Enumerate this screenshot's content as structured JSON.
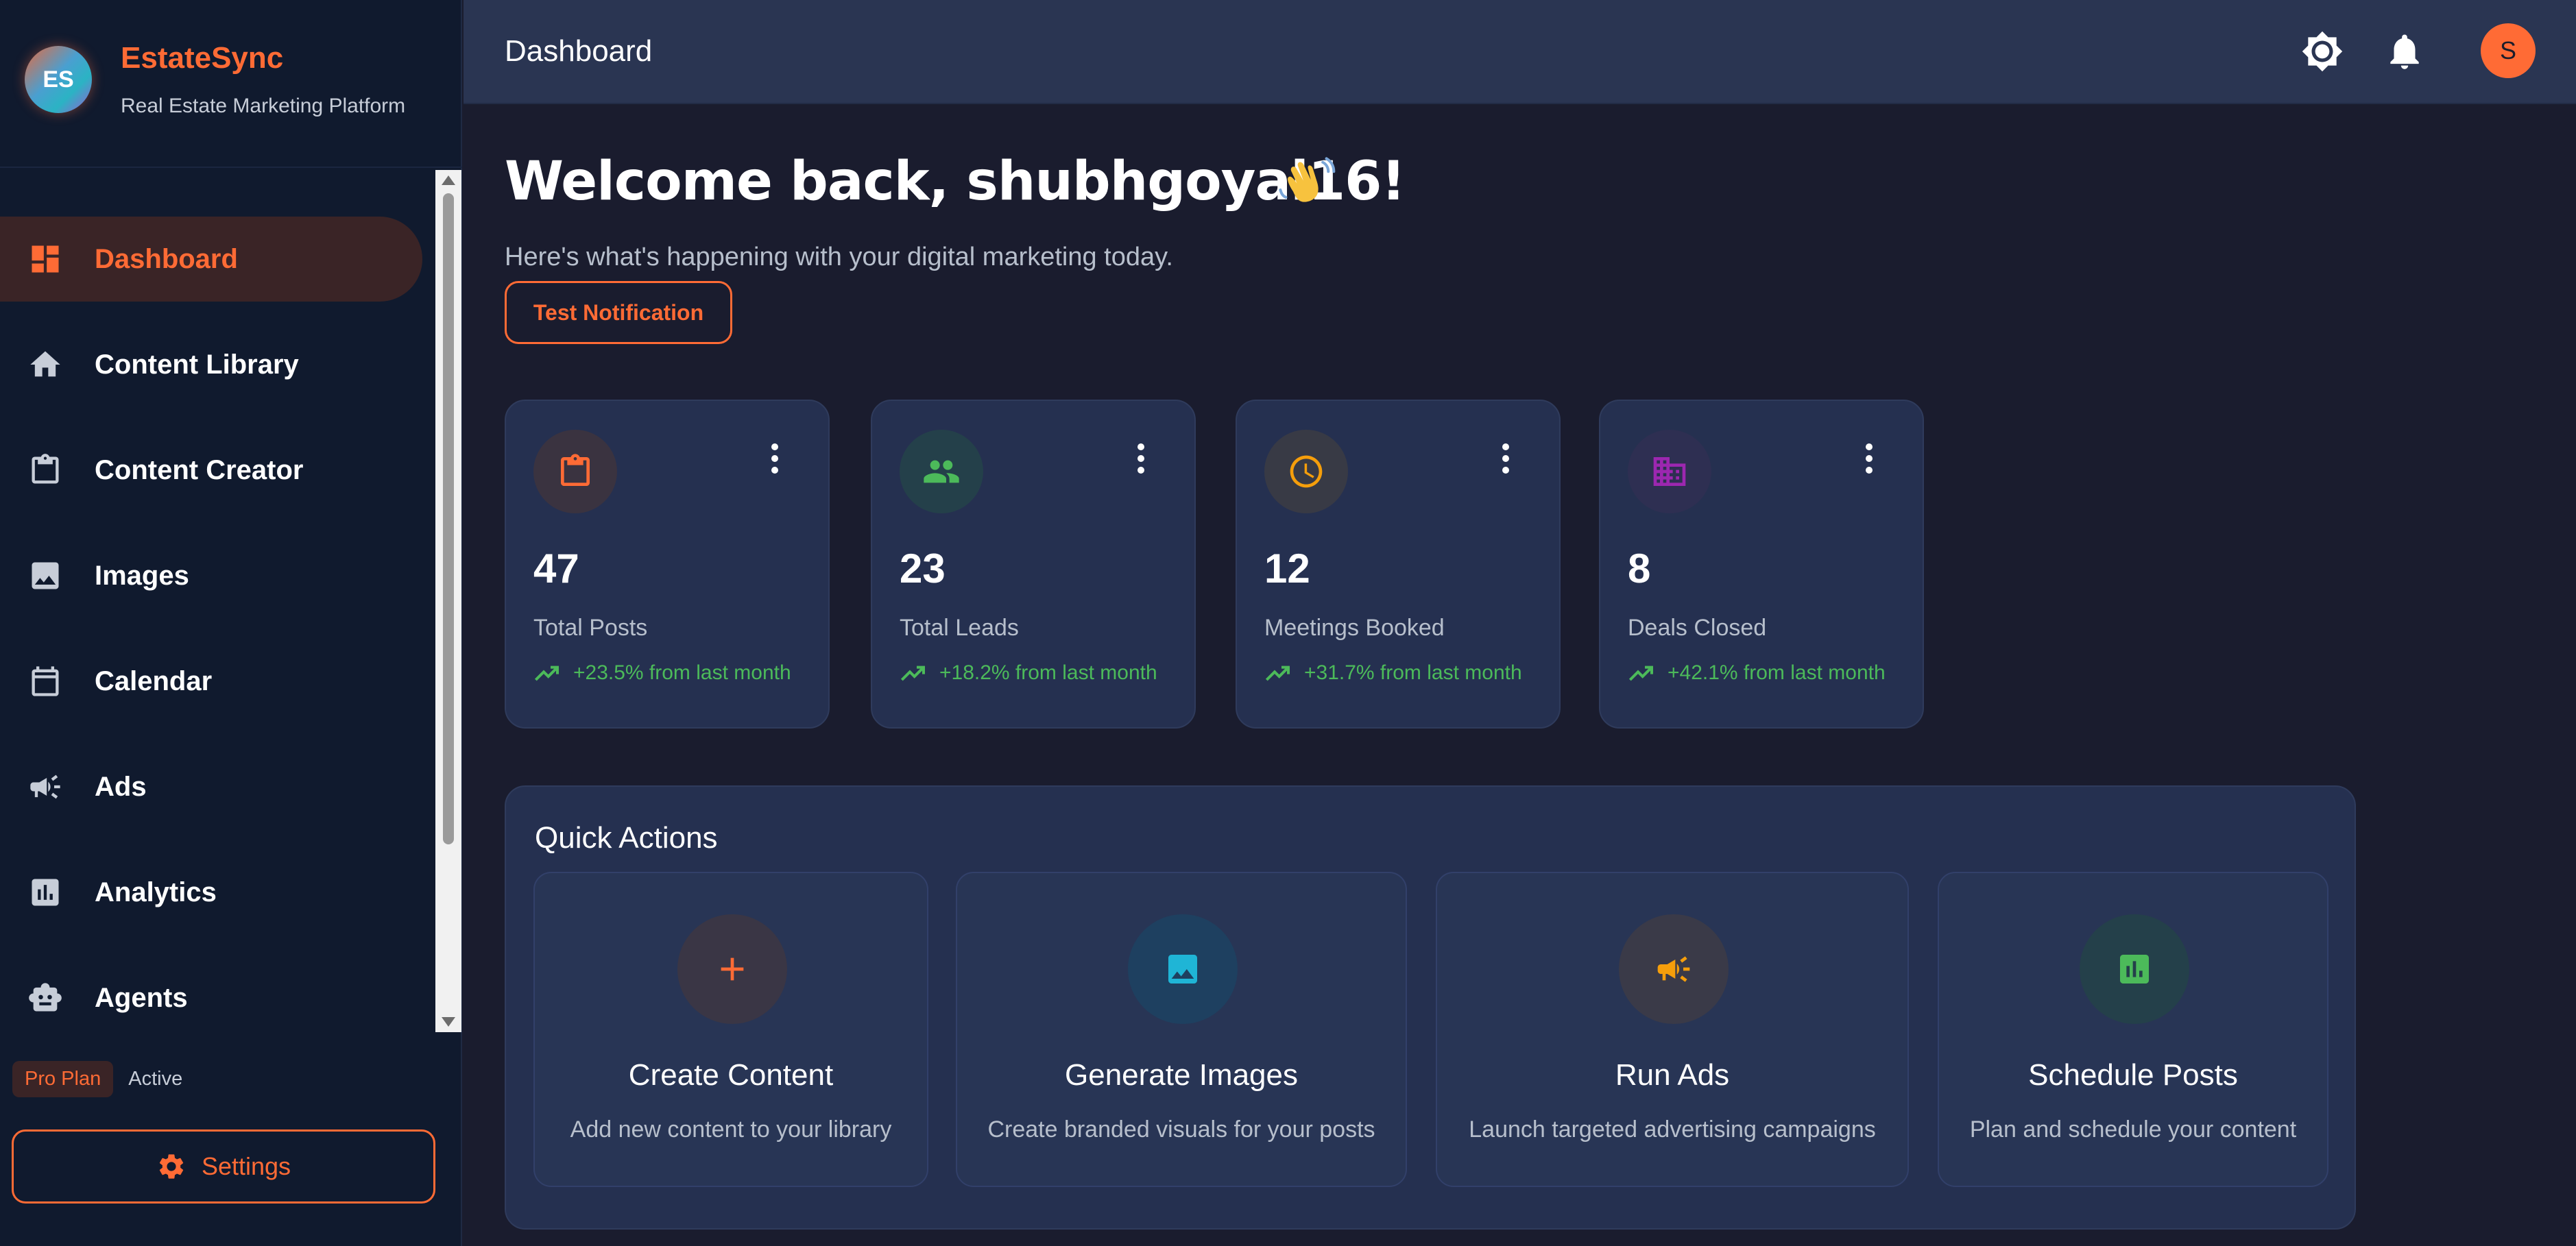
{
  "brand": {
    "logo_text": "ES",
    "name": "EstateSync",
    "tagline": "Real Estate Marketing Platform"
  },
  "sidebar": {
    "items": [
      {
        "label": "Dashboard",
        "icon": "dashboard-icon",
        "active": true
      },
      {
        "label": "Content Library",
        "icon": "home-icon",
        "active": false
      },
      {
        "label": "Content Creator",
        "icon": "clipboard-icon",
        "active": false
      },
      {
        "label": "Images",
        "icon": "image-icon",
        "active": false
      },
      {
        "label": "Calendar",
        "icon": "calendar-icon",
        "active": false
      },
      {
        "label": "Ads",
        "icon": "megaphone-icon",
        "active": false
      },
      {
        "label": "Analytics",
        "icon": "analytics-icon",
        "active": false
      },
      {
        "label": "Agents",
        "icon": "robot-icon",
        "active": false
      }
    ],
    "plan_badge": "Pro Plan",
    "plan_status": "Active",
    "settings_label": "Settings"
  },
  "header": {
    "title": "Dashboard",
    "avatar_initial": "S"
  },
  "main": {
    "welcome": "Welcome back, shubhgoyal16!",
    "subtitle": "Here's what's happening with your digital marketing today.",
    "test_button": "Test Notification"
  },
  "stats": [
    {
      "value": "47",
      "label": "Total Posts",
      "trend": "+23.5% from last month",
      "icon": "clipboard-icon",
      "color": "#ff6b35",
      "bg": "#3a3340"
    },
    {
      "value": "23",
      "label": "Total Leads",
      "trend": "+18.2% from last month",
      "icon": "people-icon",
      "color": "#4cba5a",
      "bg": "#24404a"
    },
    {
      "value": "12",
      "label": "Meetings Booked",
      "trend": "+31.7% from last month",
      "icon": "clock-icon",
      "color": "#f59e0b",
      "bg": "#383a45"
    },
    {
      "value": "8",
      "label": "Deals Closed",
      "trend": "+42.1% from last month",
      "icon": "building-icon",
      "color": "#9c27b0",
      "bg": "#2e2f52"
    }
  ],
  "quick_actions": {
    "title": "Quick Actions",
    "items": [
      {
        "name": "Create Content",
        "desc": "Add new content to your library",
        "icon": "plus-icon",
        "color": "#ff6b35",
        "bg": "#3a3645"
      },
      {
        "name": "Generate Images",
        "desc": "Create branded visuals for your posts",
        "icon": "image-icon",
        "color": "#1fb5d6",
        "bg": "#1e4060"
      },
      {
        "name": "Run Ads",
        "desc": "Launch targeted advertising campaigns",
        "icon": "megaphone-icon",
        "color": "#f59e0b",
        "bg": "#3a3a48"
      },
      {
        "name": "Schedule Posts",
        "desc": "Plan and schedule your content",
        "icon": "analytics-icon",
        "color": "#4cba5a",
        "bg": "#24404a"
      }
    ]
  },
  "colors": {
    "accent": "#ff6b35",
    "success": "#4cba5a",
    "sidebar_bg": "#101a2e",
    "header_bg": "#2a3552",
    "page_bg": "#1a1c2e",
    "card_bg": "#253050"
  }
}
